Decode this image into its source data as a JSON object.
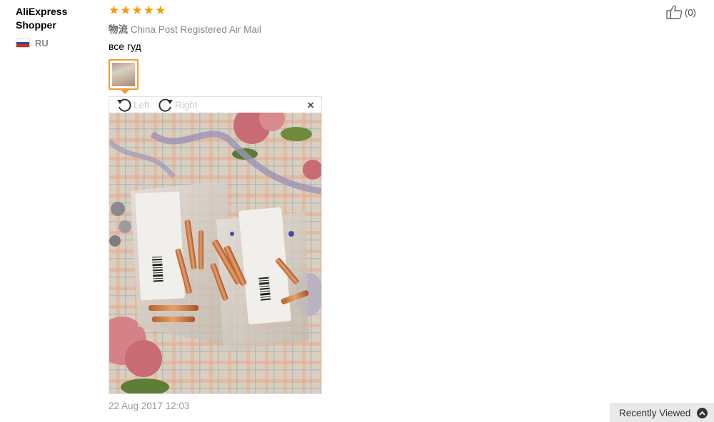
{
  "reviewer": {
    "name": "AliExpress Shopper",
    "country": "RU",
    "flag_colors": [
      "#ffffff",
      "#1f4fa8",
      "#d52b1e"
    ]
  },
  "rating": {
    "stars": 5,
    "max": 5,
    "color": "#f59b00"
  },
  "logistics": {
    "label": "物流",
    "value": "China Post Registered Air Mail"
  },
  "review_text": "все гуд",
  "viewer": {
    "rotate_left_label": "Left",
    "rotate_right_label": "Right",
    "close_symbol": "×"
  },
  "date": "22 Aug 2017 12:03",
  "helpful": {
    "count_text": "(0)",
    "icon": "thumbs-up-icon"
  },
  "recently_viewed": {
    "label": "Recently Viewed",
    "icon": "chevron-up-icon"
  },
  "accent_color": "#f39c2c"
}
